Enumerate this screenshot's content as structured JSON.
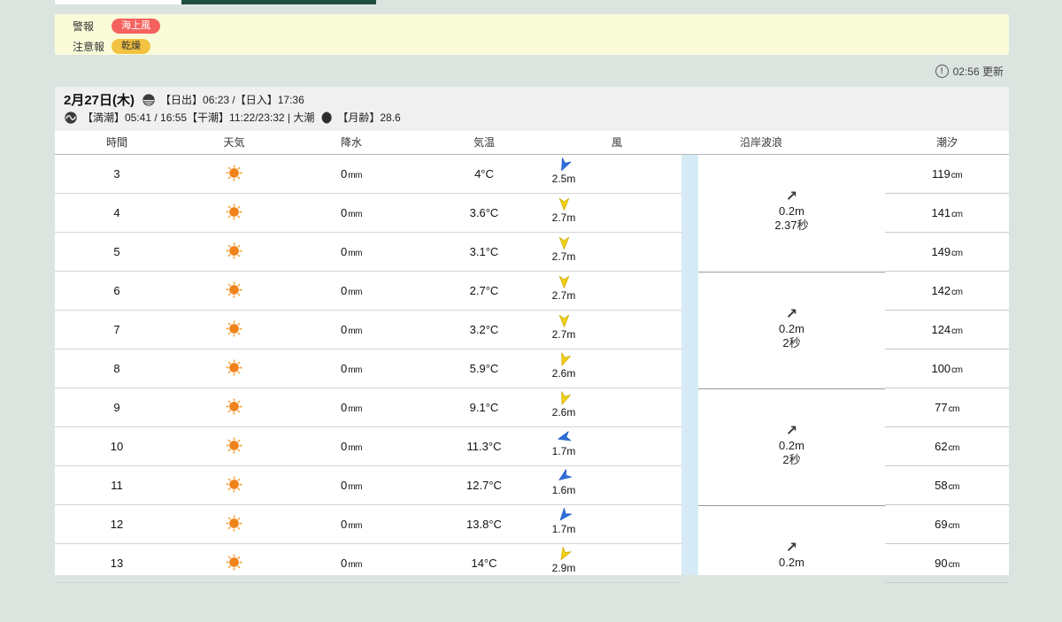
{
  "page": {
    "bg": "#dce4e0",
    "tab_fragment_colors": {
      "inactive": "#ffffff",
      "active_green": "#1d4f3c"
    },
    "update": {
      "icon": "!",
      "time": "02:56 更新"
    }
  },
  "alert_banner": {
    "bg": "#fafcd9",
    "rows": [
      {
        "label": "警報",
        "badges": [
          {
            "text": "海上風",
            "bg": "#f4625f",
            "color": "#ffffff"
          }
        ]
      },
      {
        "label": "注意報",
        "badges": [
          {
            "text": "乾燥",
            "bg": "#f3c241",
            "color": "#333333"
          }
        ]
      }
    ]
  },
  "date_header": {
    "date": "2月27日(木)",
    "sun_text": "【日出】06:23 /【日入】17:36",
    "tide_text": "【満潮】05:41 / 16:55【干潮】11:22/23:32 | 大潮",
    "moon_text": "【月齢】28.6",
    "icons": [
      "sunrise-sunset-icon",
      "tide-icon",
      "moon-age-icon"
    ]
  },
  "table": {
    "headers": [
      "時間",
      "天気",
      "降水",
      "気温",
      "風",
      "沿岸波浪",
      "潮汐"
    ],
    "units": {
      "precip": "mm",
      "tide": "cm"
    },
    "weather_icon": "sunny-icon",
    "wind_colors": {
      "strong_yellow": "#f2d013",
      "moderate_blue": "#2f6edb"
    },
    "rows": [
      {
        "hour": "3",
        "weather": "sunny",
        "precip": "0",
        "temp": "4°C",
        "wind": {
          "speed": "2.5m",
          "fill": "#2f6edb",
          "stroke": "#2a62c4",
          "deg": 25
        },
        "tide": "119"
      },
      {
        "hour": "4",
        "weather": "sunny",
        "precip": "0",
        "temp": "3.6°C",
        "wind": {
          "speed": "2.7m",
          "fill": "#f2d013",
          "stroke": "#c9a60f",
          "deg": 0
        },
        "tide": "141"
      },
      {
        "hour": "5",
        "weather": "sunny",
        "precip": "0",
        "temp": "3.1°C",
        "wind": {
          "speed": "2.7m",
          "fill": "#f2d013",
          "stroke": "#c9a60f",
          "deg": 0
        },
        "tide": "149"
      },
      {
        "hour": "6",
        "weather": "sunny",
        "precip": "0",
        "temp": "2.7°C",
        "wind": {
          "speed": "2.7m",
          "fill": "#f2d013",
          "stroke": "#c9a60f",
          "deg": 0
        },
        "tide": "142"
      },
      {
        "hour": "7",
        "weather": "sunny",
        "precip": "0",
        "temp": "3.2°C",
        "wind": {
          "speed": "2.7m",
          "fill": "#f2d013",
          "stroke": "#c9a60f",
          "deg": 0
        },
        "tide": "124"
      },
      {
        "hour": "8",
        "weather": "sunny",
        "precip": "0",
        "temp": "5.9°C",
        "wind": {
          "speed": "2.6m",
          "fill": "#f2d013",
          "stroke": "#c9a60f",
          "deg": 20
        },
        "tide": "100"
      },
      {
        "hour": "9",
        "weather": "sunny",
        "precip": "0",
        "temp": "9.1°C",
        "wind": {
          "speed": "2.6m",
          "fill": "#f2d013",
          "stroke": "#c9a60f",
          "deg": 20
        },
        "tide": "77"
      },
      {
        "hour": "10",
        "weather": "sunny",
        "precip": "0",
        "temp": "11.3°C",
        "wind": {
          "speed": "1.7m",
          "fill": "#2f6edb",
          "stroke": "#2a62c4",
          "deg": 75
        },
        "tide": "62"
      },
      {
        "hour": "11",
        "weather": "sunny",
        "precip": "0",
        "temp": "12.7°C",
        "wind": {
          "speed": "1.6m",
          "fill": "#2f6edb",
          "stroke": "#2a62c4",
          "deg": 55
        },
        "tide": "58"
      },
      {
        "hour": "12",
        "weather": "sunny",
        "precip": "0",
        "temp": "13.8°C",
        "wind": {
          "speed": "1.7m",
          "fill": "#2f6edb",
          "stroke": "#2a62c4",
          "deg": 40
        },
        "tide": "69"
      },
      {
        "hour": "13",
        "weather": "sunny",
        "precip": "0",
        "temp": "14°C",
        "wind": {
          "speed": "2.9m",
          "fill": "#f2d013",
          "stroke": "#c9a60f",
          "deg": 30
        },
        "tide": "90"
      }
    ],
    "wave_groups": [
      {
        "arrow": "↗",
        "height": "0.2m",
        "period": "2.37秒"
      },
      {
        "arrow": "↗",
        "height": "0.2m",
        "period": "2秒"
      },
      {
        "arrow": "↗",
        "height": "0.2m",
        "period": "2秒"
      },
      {
        "arrow": "↗",
        "height": "0.2m",
        "period": ""
      }
    ]
  }
}
